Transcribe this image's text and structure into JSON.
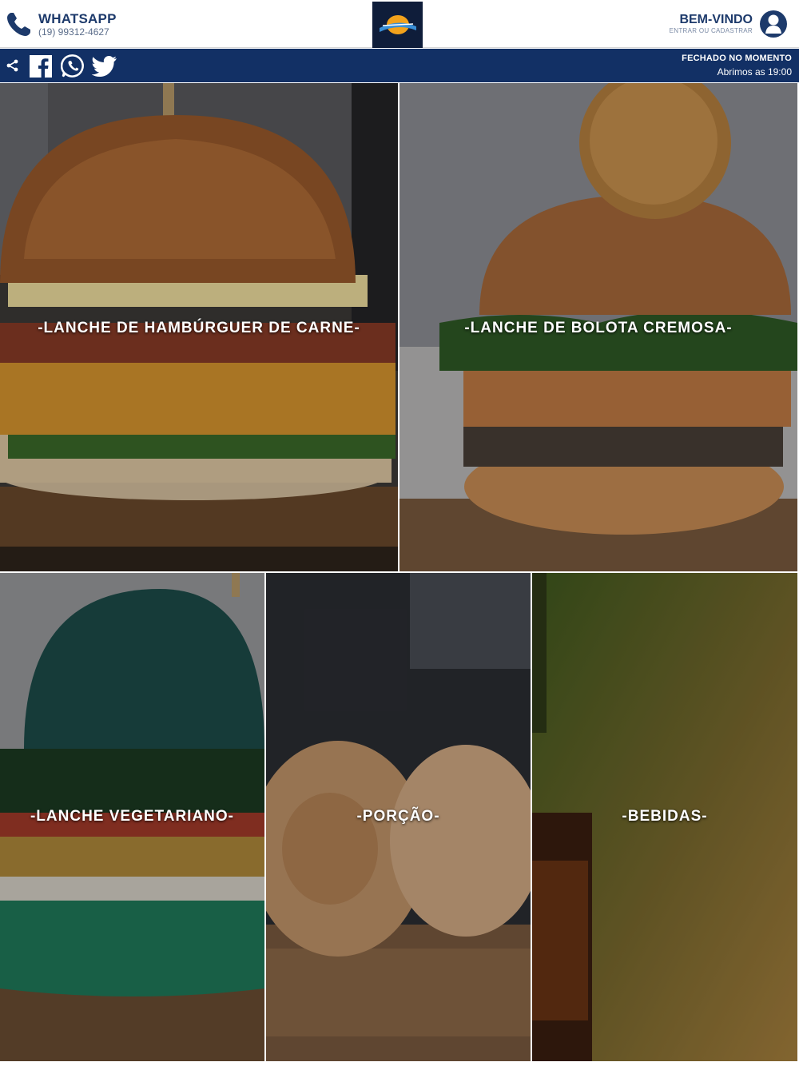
{
  "header": {
    "whatsapp_title": "WHATSAPP",
    "whatsapp_number": "(19) 99312-4627",
    "welcome_title": "BEM-VINDO",
    "welcome_subtitle": "ENTRAR OU CADASTRAR",
    "icons": [
      "phone-icon",
      "logo",
      "user-icon"
    ]
  },
  "navbar": {
    "icons": [
      "share-icon",
      "facebook-icon",
      "whatsapp-icon",
      "twitter-icon"
    ],
    "status_closed": "FECHADO NO MOMENTO",
    "status_opens": "Abrimos as 19:00"
  },
  "categories": [
    {
      "label": "-LANCHE DE HAMBÚRGUER DE CARNE-"
    },
    {
      "label": "-LANCHE DE BOLOTA CREMOSA-"
    },
    {
      "label": "-LANCHE VEGETARIANO-"
    },
    {
      "label": "-PORÇÃO-"
    },
    {
      "label": "-BEBIDAS-"
    }
  ],
  "colors": {
    "brand_navy": "#123065",
    "header_text": "#1d3a6b",
    "logo_bg": "#0f1d3a"
  }
}
